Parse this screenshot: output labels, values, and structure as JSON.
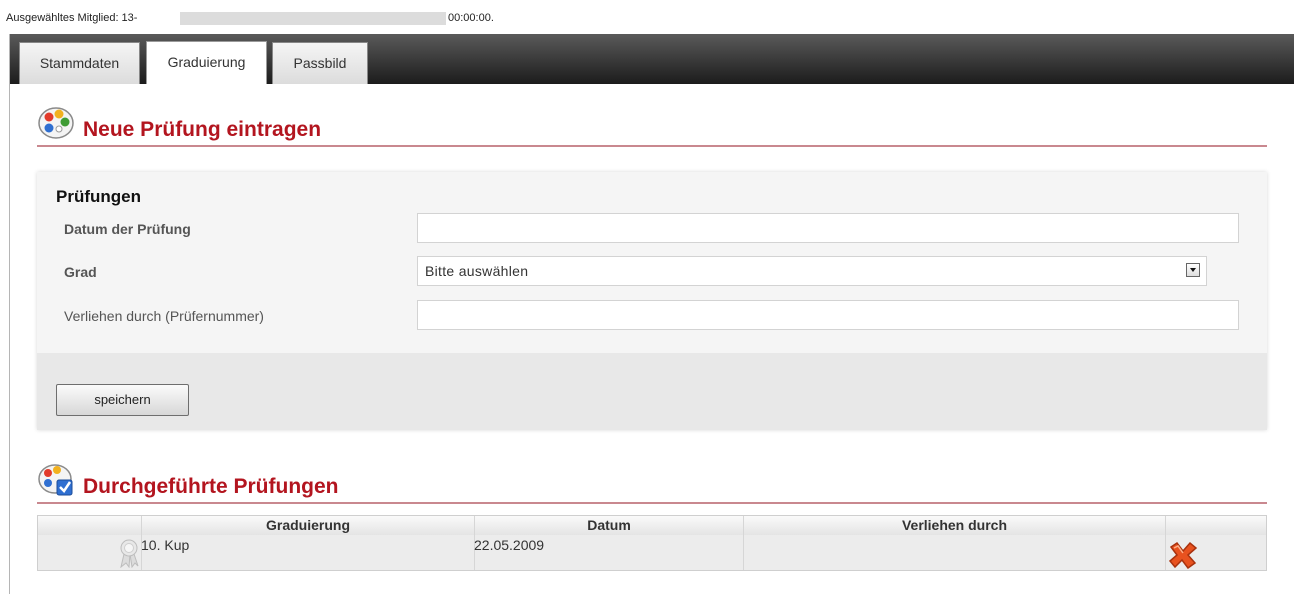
{
  "header": {
    "selected_member_label": "Ausgewähltes Mitglied: 13-",
    "time": "00:00:00."
  },
  "tabs": [
    {
      "label": "Stammdaten",
      "active": false
    },
    {
      "label": "Graduierung",
      "active": true
    },
    {
      "label": "Passbild",
      "active": false
    }
  ],
  "new_exam": {
    "title": "Neue Prüfung eintragen",
    "legend": "Prüfungen",
    "date_label": "Datum der Prüfung",
    "date_value": "",
    "grade_label": "Grad",
    "grade_selected": "Bitte auswählen",
    "awarded_by_label": "Verliehen durch (Prüfernummer)",
    "awarded_by_value": "",
    "save_label": "speichern"
  },
  "done_exams": {
    "title": "Durchgeführte Prüfungen",
    "columns": [
      "Graduierung",
      "Datum",
      "Verliehen durch"
    ],
    "rows": [
      {
        "grade": "10. Kup",
        "date": "22.05.2009",
        "awarded_by": ""
      }
    ]
  },
  "colors": {
    "accent": "#b3151f",
    "section_line": "#c9888f",
    "tabbar_dark": "#1c1c1c"
  },
  "icons": [
    "palette-icon",
    "palette-check-icon",
    "ribbon-icon",
    "delete-icon"
  ]
}
